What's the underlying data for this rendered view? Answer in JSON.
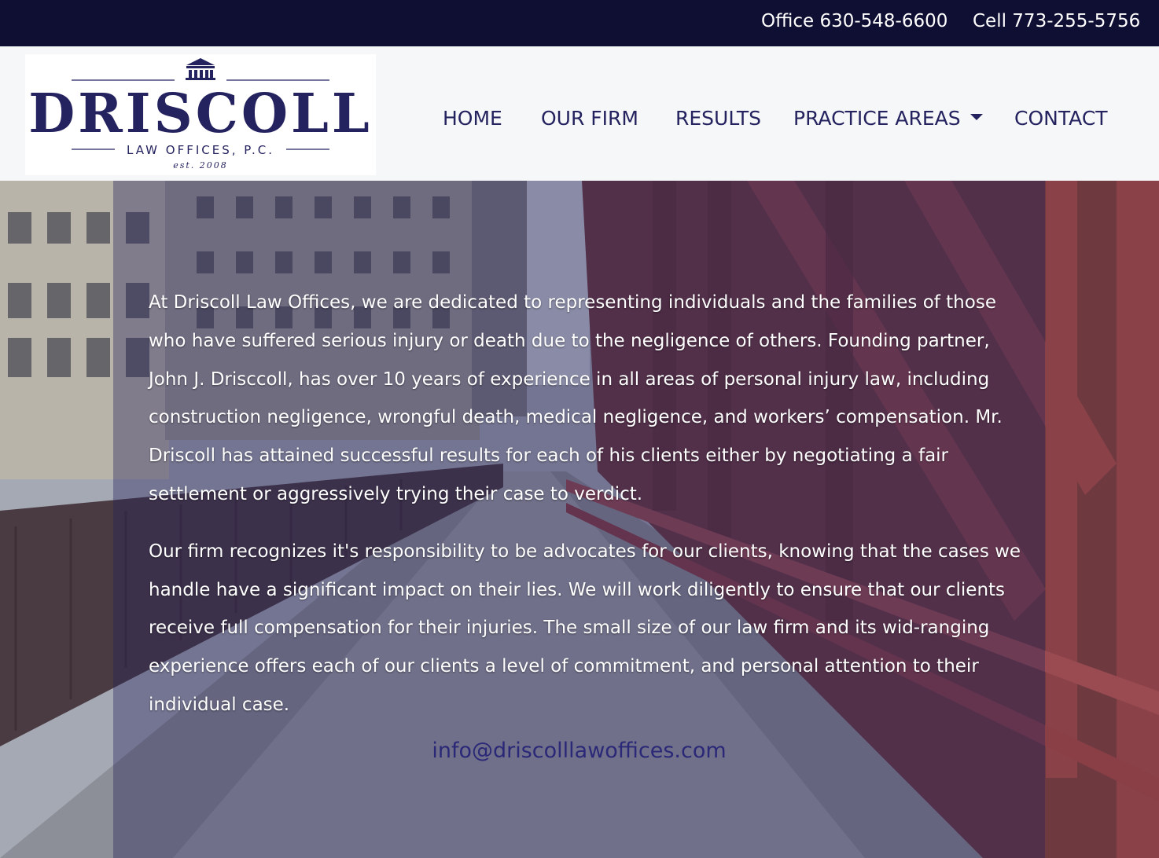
{
  "topbar": {
    "office": "Office 630-548-6600",
    "cell": "Cell 773-255-5756"
  },
  "logo": {
    "icon": "courthouse-icon",
    "name": "DRISCOLL",
    "subtitle": "LAW OFFICES, P.C.",
    "established": "est. 2008"
  },
  "nav": {
    "home": "HOME",
    "our_firm": "OUR FIRM",
    "results": "RESULTS",
    "practice_areas": "PRACTICE AREAS",
    "contact": "CONTACT"
  },
  "content": {
    "paragraph_1": "At Driscoll Law Offices, we are dedicated to representing individuals and the families of those who have suffered serious injury or death due to the negligence of others. Founding partner, John J. Drisccoll, has over 10 years of experience in all areas of personal injury law, including construction negligence, wrongful death, medical negligence, and workers’ compensation. Mr. Driscoll has attained successful results for each of his clients either by negotiating a fair settlement or aggressively trying their case to verdict.",
    "paragraph_2": "Our firm recognizes it's responsibility to be advocates for our clients, knowing that the cases we handle have a significant impact on their lies. We will work diligently to ensure that our clients receive full compensation for their injuries. The small size of our law firm and its wid-ranging experience offers each of our clients a level of commitment, and personal attention to their individual case.",
    "email": "info@driscolllawoffices.com"
  },
  "colors": {
    "topbar": "#0f0e33",
    "brand": "#25235f",
    "header_bg": "#f6f7f9",
    "email": "#2a2877"
  }
}
